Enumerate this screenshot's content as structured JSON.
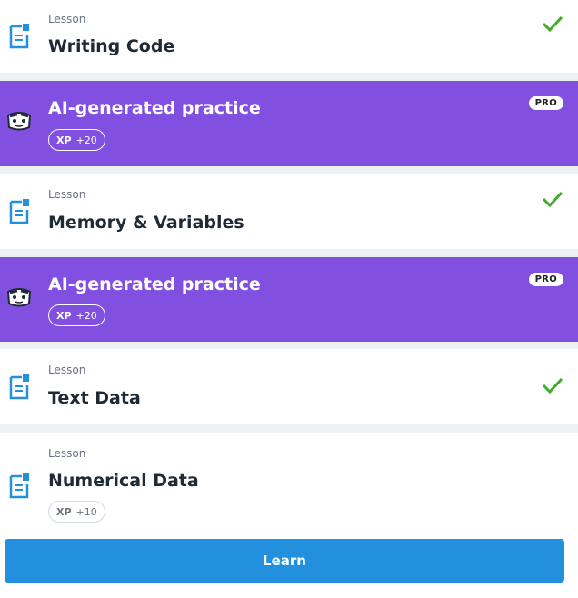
{
  "items": [
    {
      "kind": "lesson",
      "eyebrow": "Lesson",
      "title": "Writing Code",
      "completed": true,
      "icon": "document-icon"
    },
    {
      "kind": "practice",
      "title": "AI-generated practice",
      "badge": "PRO",
      "xp_label": "XP",
      "xp_value": "+20",
      "icon": "robot-face-icon"
    },
    {
      "kind": "lesson",
      "eyebrow": "Lesson",
      "title": "Memory & Variables",
      "completed": true,
      "icon": "document-icon"
    },
    {
      "kind": "practice",
      "title": "AI-generated practice",
      "badge": "PRO",
      "xp_label": "XP",
      "xp_value": "+20",
      "icon": "robot-face-icon"
    },
    {
      "kind": "lesson",
      "eyebrow": "Lesson",
      "title": "Text Data",
      "completed": true,
      "icon": "document-icon"
    },
    {
      "kind": "lesson",
      "eyebrow": "Lesson",
      "title": "Numerical Data",
      "completed": false,
      "xp_label": "XP",
      "xp_value": "+10",
      "icon": "document-icon"
    }
  ],
  "learn_button": {
    "label": "Learn"
  },
  "colors": {
    "promo_bg": "#8150e0",
    "check": "#3fae29",
    "doc_icon": "#2390dd",
    "button": "#2390dd"
  }
}
